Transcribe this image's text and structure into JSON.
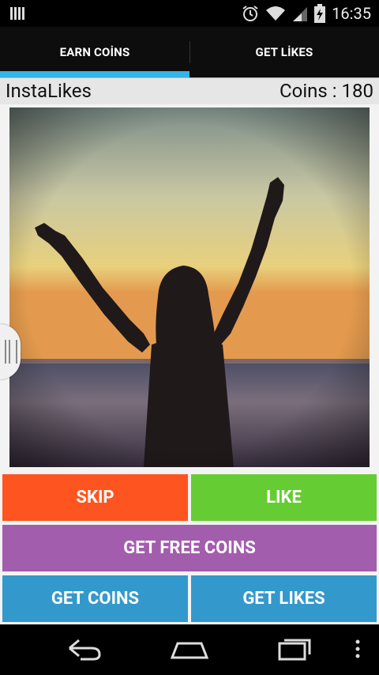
{
  "status_bar": {
    "time": "16:35",
    "icons": [
      "notification-bars-icon",
      "alarm-icon",
      "wifi-icon",
      "signal-icon",
      "battery-charging-icon"
    ]
  },
  "tabs": [
    {
      "label": "EARN COİNS",
      "active": true
    },
    {
      "label": "GET LİKES",
      "active": false
    }
  ],
  "info_bar": {
    "app_name": "InstaLikes",
    "coins_text": "Coins : 180"
  },
  "actions": {
    "skip": "SKIP",
    "like": "LIKE",
    "free_coins": "GET FREE COINS",
    "get_coins": "GET COINS",
    "get_likes": "GET LIKES"
  },
  "colors": {
    "accent": "#33b5e5",
    "skip": "#fe5420",
    "like": "#66cc33",
    "free_coins": "#a35dad",
    "blue_buttons": "#3399cc"
  },
  "nav_bar": {
    "icons": [
      "back-icon",
      "home-icon",
      "recent-apps-icon",
      "menu-icon"
    ]
  }
}
